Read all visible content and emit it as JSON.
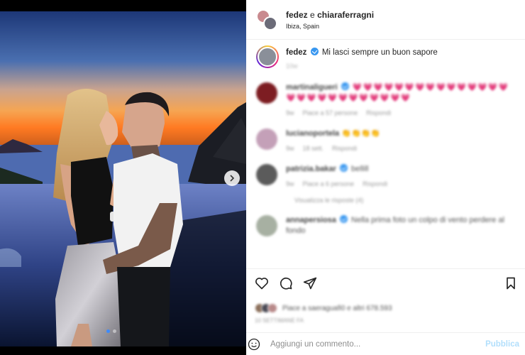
{
  "header": {
    "user1": "fedez",
    "separator": "e",
    "user2": "chiaraferragni",
    "location": "Ibiza, Spain"
  },
  "caption": {
    "username": "fedez",
    "text": "Mi lasci sempre un buon sapore",
    "time": "10w"
  },
  "comments": [
    {
      "user": "martinaligueri",
      "text": "💗💗💗💗💗💗💗💗💗💗💗💗💗💗💗💗💗💗💗💗💗💗💗💗💗💗💗",
      "likes": "Piace a 57 persone",
      "reply": "Rispondi",
      "time": "9w"
    },
    {
      "user": "lucianoportela",
      "text": "👏👏👏👏",
      "likes": "18 sett.",
      "reply": "Rispondi",
      "time": "9w"
    },
    {
      "user": "patrizia.bakar",
      "text": "bellill",
      "likes": "Piace a 6 persone",
      "reply": "Rispondi",
      "time": "9w"
    },
    {
      "user": "annapersiosa",
      "text": "Nella prima foto un colpo di vento perdere al fondo",
      "likes": "",
      "reply": "",
      "time": ""
    }
  ],
  "view_replies": "Visualizza le risposte (4)",
  "likes": {
    "text": "Piace a saeraguafi0 e altri 678.593",
    "time": "10 SETTIMANE FA"
  },
  "add_comment": {
    "placeholder": "Aggiungi un commento...",
    "publish_label": "Pubblica"
  },
  "colors": {
    "accent": "#3897f0",
    "publish_disabled": "#b2dffc",
    "heart": "#ed4956"
  },
  "carousel": {
    "slide_count": 2,
    "active_slide": 1
  }
}
